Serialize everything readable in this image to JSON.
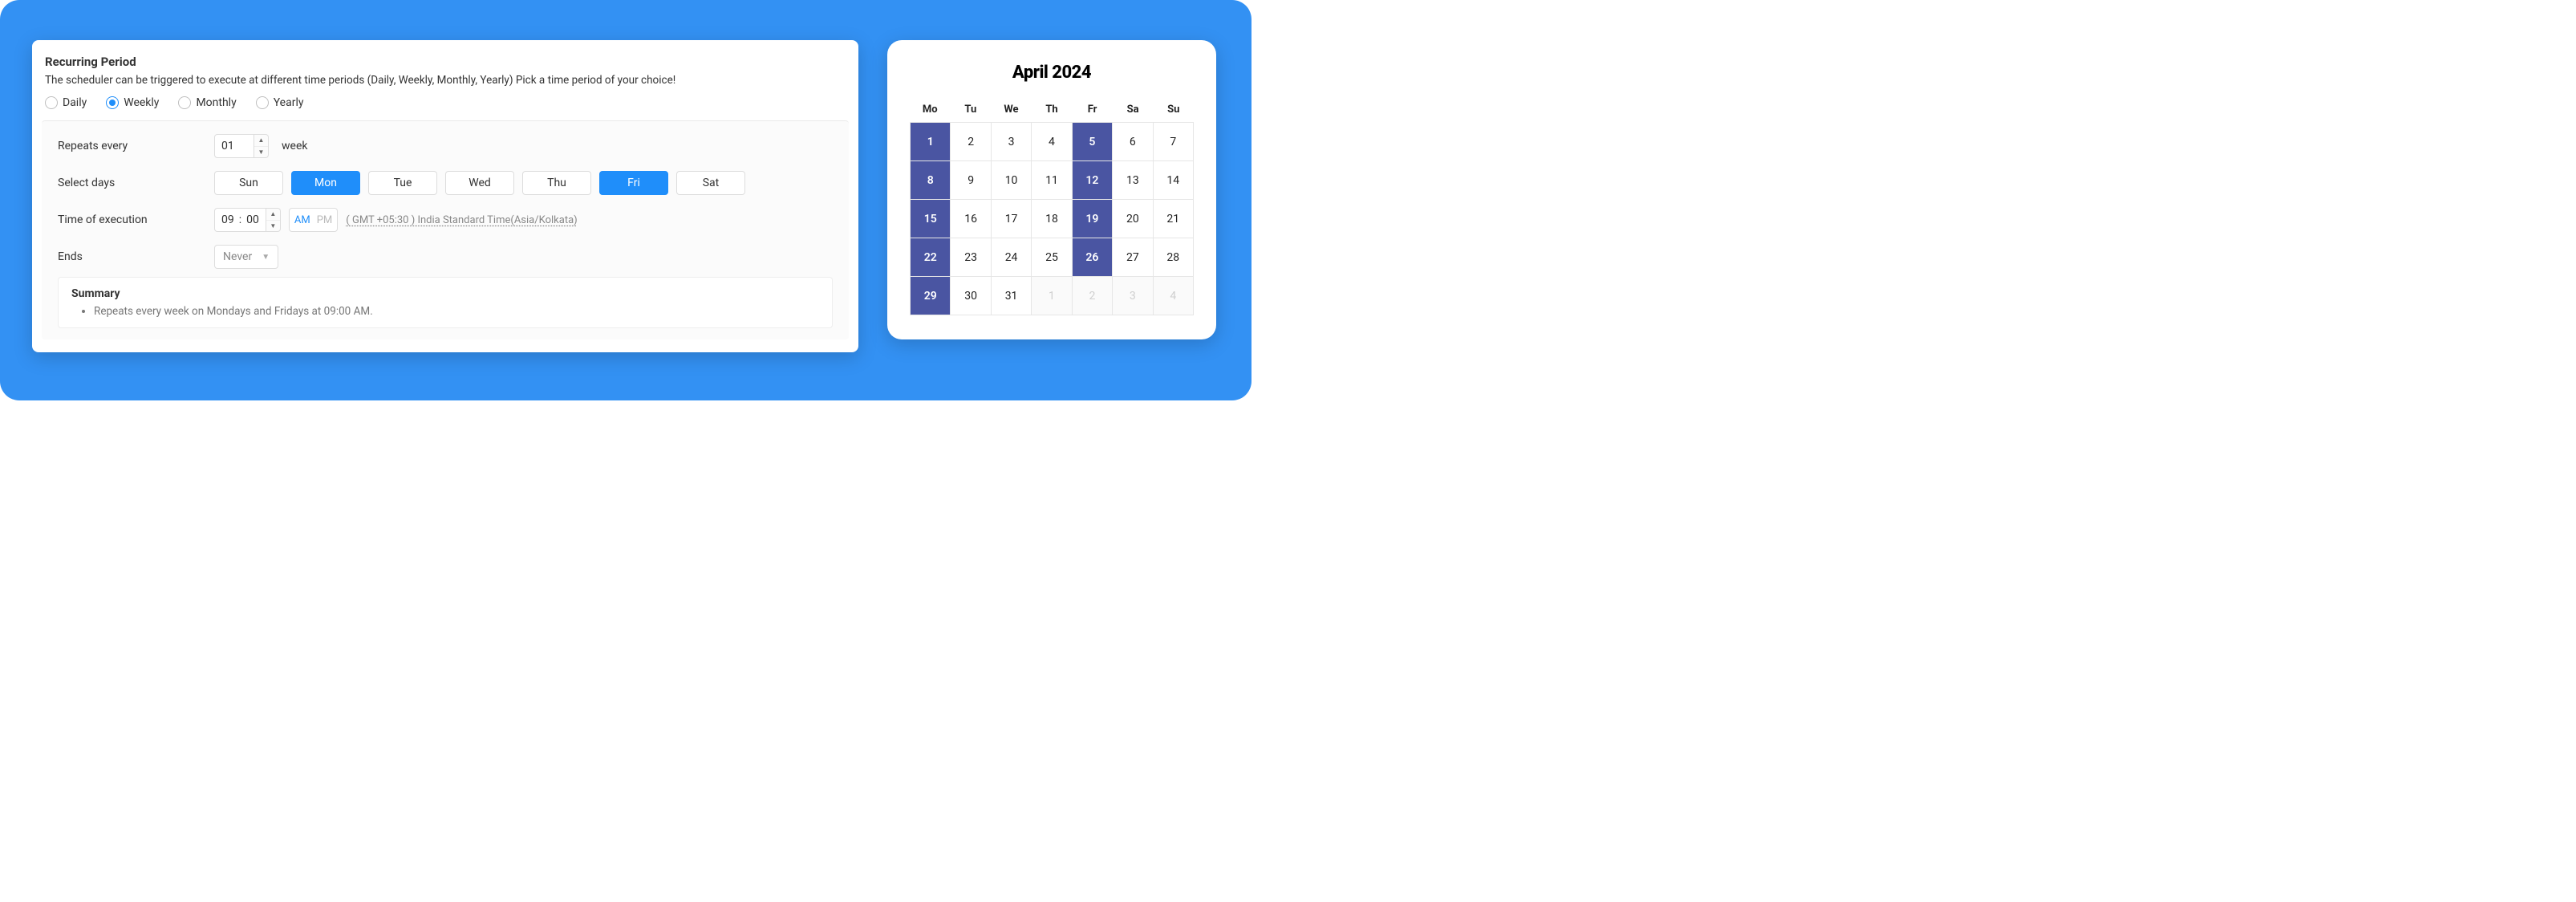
{
  "recurring": {
    "title": "Recurring Period",
    "description": "The scheduler can be triggered to execute at different time periods (Daily, Weekly, Monthly, Yearly) Pick a time period of your choice!",
    "periods": [
      "Daily",
      "Weekly",
      "Monthly",
      "Yearly"
    ],
    "selected_period": "Weekly",
    "labels": {
      "repeats_every": "Repeats every",
      "repeat_unit": "week",
      "select_days": "Select days",
      "time_of_execution": "Time of execution",
      "ends": "Ends"
    },
    "repeat_value": "01",
    "days": [
      {
        "label": "Sun",
        "selected": false
      },
      {
        "label": "Mon",
        "selected": true
      },
      {
        "label": "Tue",
        "selected": false
      },
      {
        "label": "Wed",
        "selected": false
      },
      {
        "label": "Thu",
        "selected": false
      },
      {
        "label": "Fri",
        "selected": true
      },
      {
        "label": "Sat",
        "selected": false
      }
    ],
    "time": {
      "hh": "09",
      "mm": "00",
      "ampm": "AM",
      "am_label": "AM",
      "pm_label": "PM"
    },
    "timezone": "( GMT +05:30 ) India Standard Time(Asia/Kolkata)",
    "ends_value": "Never",
    "summary": {
      "title": "Summary",
      "text": "Repeats every week on Mondays and Fridays at 09:00 AM."
    }
  },
  "calendar": {
    "title": "April 2024",
    "weekdays": [
      "Mo",
      "Tu",
      "We",
      "Th",
      "Fr",
      "Sa",
      "Su"
    ],
    "cells": [
      {
        "d": "1",
        "hl": true
      },
      {
        "d": "2"
      },
      {
        "d": "3"
      },
      {
        "d": "4"
      },
      {
        "d": "5",
        "hl": true
      },
      {
        "d": "6"
      },
      {
        "d": "7"
      },
      {
        "d": "8",
        "hl": true
      },
      {
        "d": "9"
      },
      {
        "d": "10"
      },
      {
        "d": "11"
      },
      {
        "d": "12",
        "hl": true
      },
      {
        "d": "13"
      },
      {
        "d": "14"
      },
      {
        "d": "15",
        "hl": true
      },
      {
        "d": "16"
      },
      {
        "d": "17"
      },
      {
        "d": "18"
      },
      {
        "d": "19",
        "hl": true
      },
      {
        "d": "20"
      },
      {
        "d": "21"
      },
      {
        "d": "22",
        "hl": true
      },
      {
        "d": "23"
      },
      {
        "d": "24"
      },
      {
        "d": "25"
      },
      {
        "d": "26",
        "hl": true
      },
      {
        "d": "27"
      },
      {
        "d": "28"
      },
      {
        "d": "29",
        "hl": true
      },
      {
        "d": "30"
      },
      {
        "d": "31"
      },
      {
        "d": "1",
        "dim": true
      },
      {
        "d": "2",
        "dim": true
      },
      {
        "d": "3",
        "dim": true
      },
      {
        "d": "4",
        "dim": true
      }
    ]
  }
}
